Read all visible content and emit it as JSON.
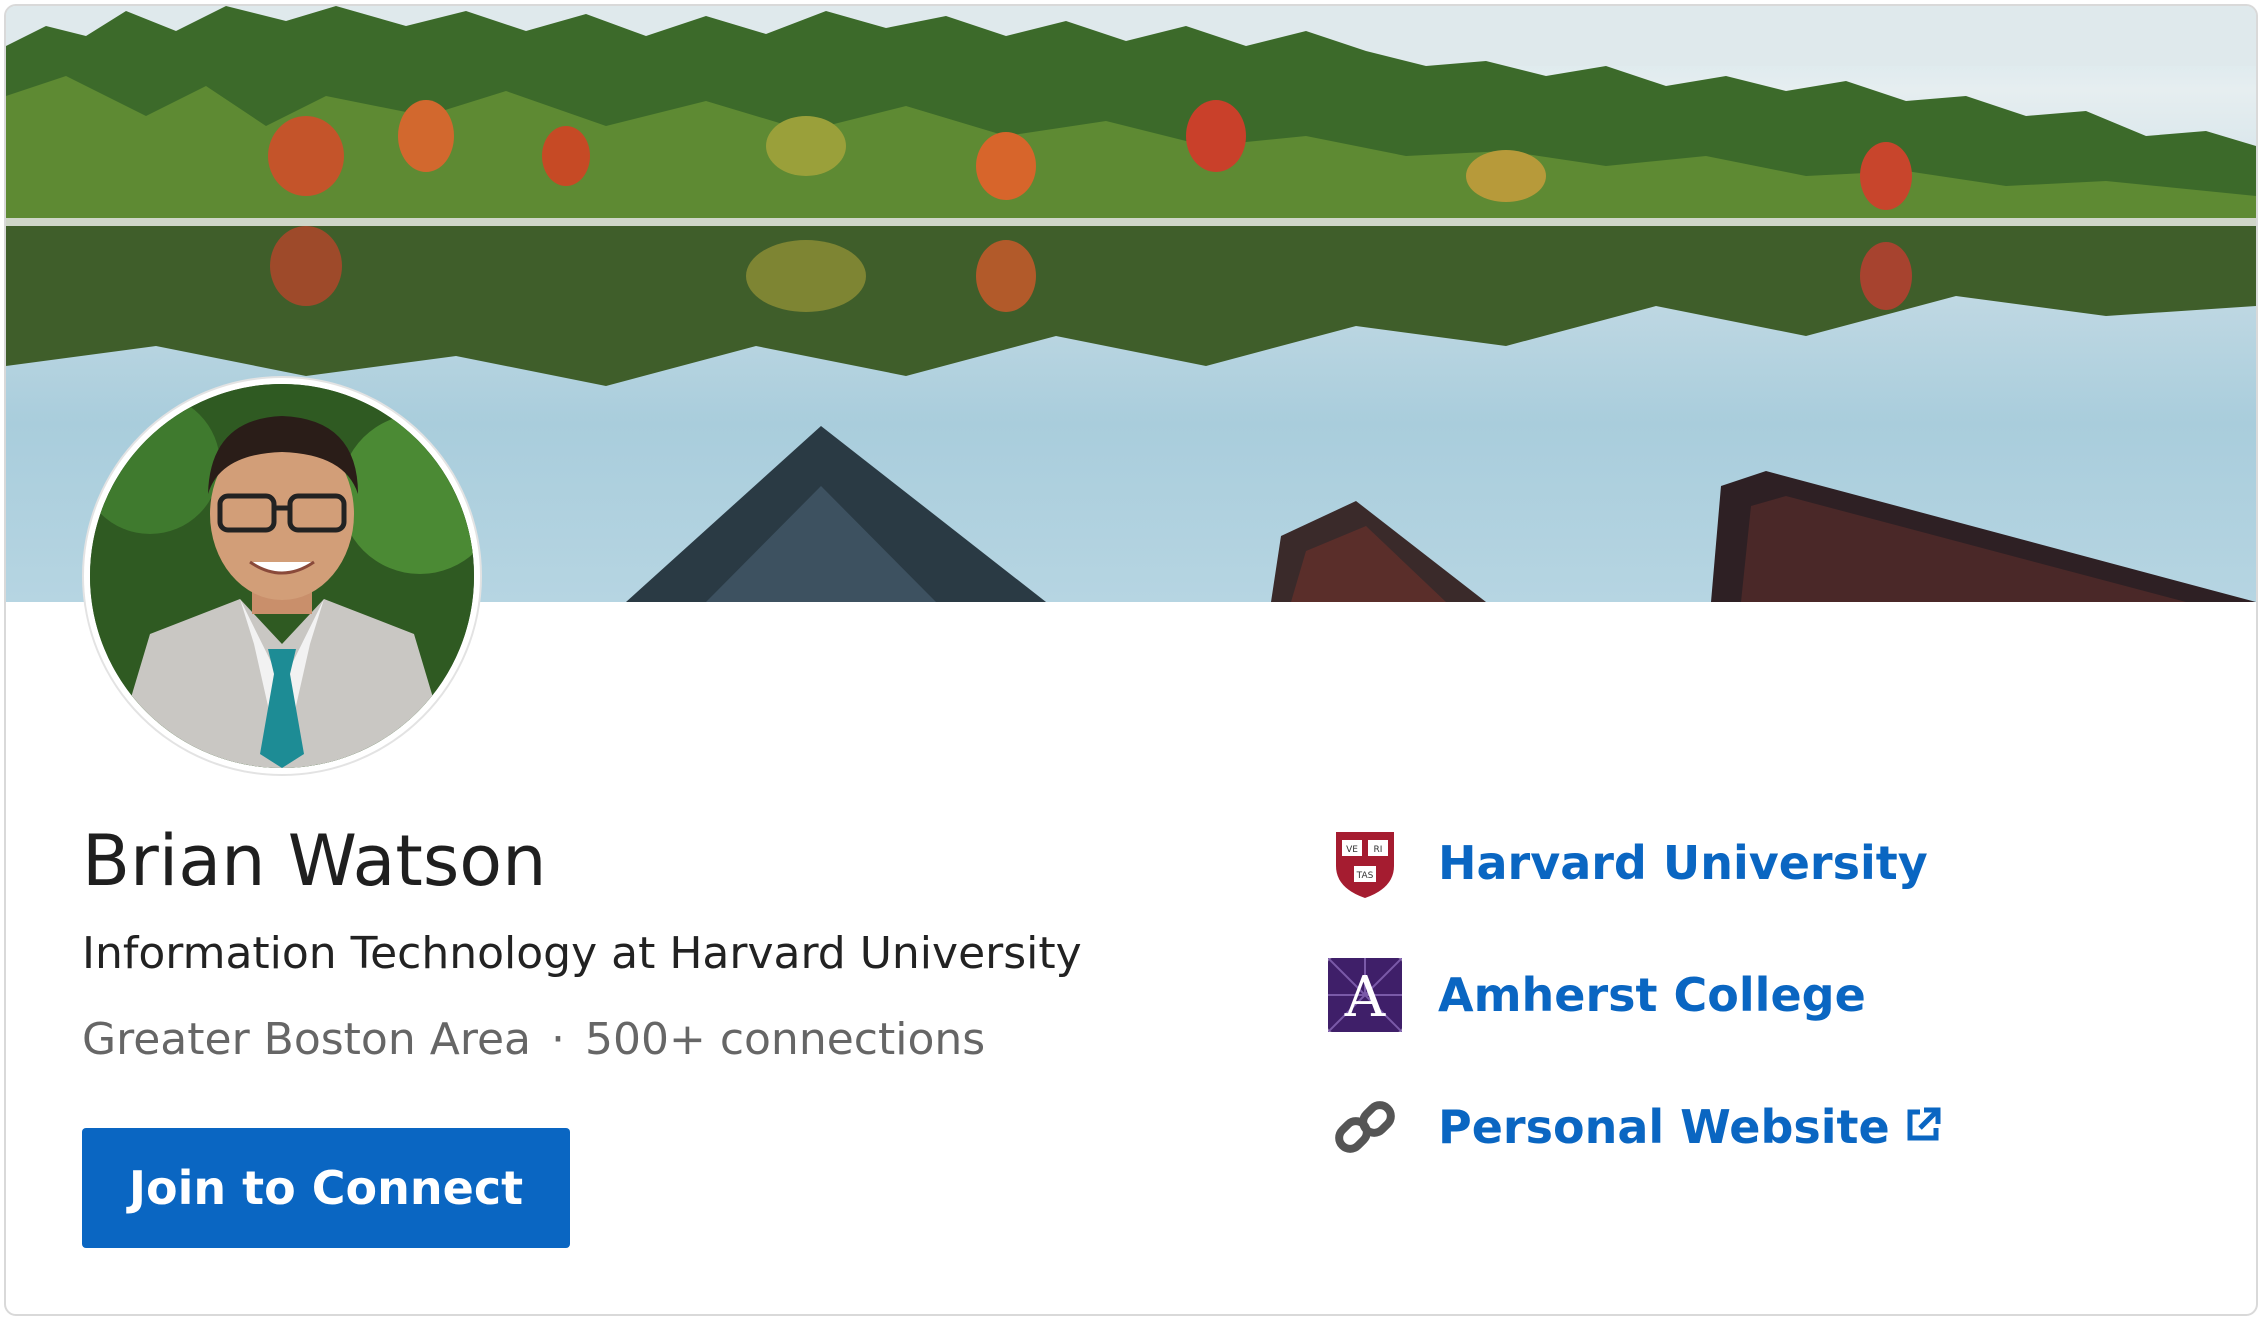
{
  "profile": {
    "name": "Brian Watson",
    "headline": "Information Technology at Harvard University",
    "location": "Greater Boston Area",
    "separator": "·",
    "connections": "500+ connections",
    "join_button": "Join to Connect"
  },
  "links": [
    {
      "label": "Harvard University",
      "icon": "harvard-shield-icon"
    },
    {
      "label": "Amherst College",
      "icon": "amherst-logo-icon",
      "icon_letter": "A"
    },
    {
      "label": "Personal Website",
      "icon": "link-chain-icon",
      "external_icon": "external-link-icon"
    }
  ],
  "harvard_shield_text": [
    "VE",
    "RI",
    "TAS"
  ],
  "colors": {
    "primary": "#0a66c2",
    "name_text": "#1f1f1f",
    "muted_text": "#666666",
    "harvard_crimson": "#a51c30",
    "amherst_purple": "#3f1f69"
  }
}
